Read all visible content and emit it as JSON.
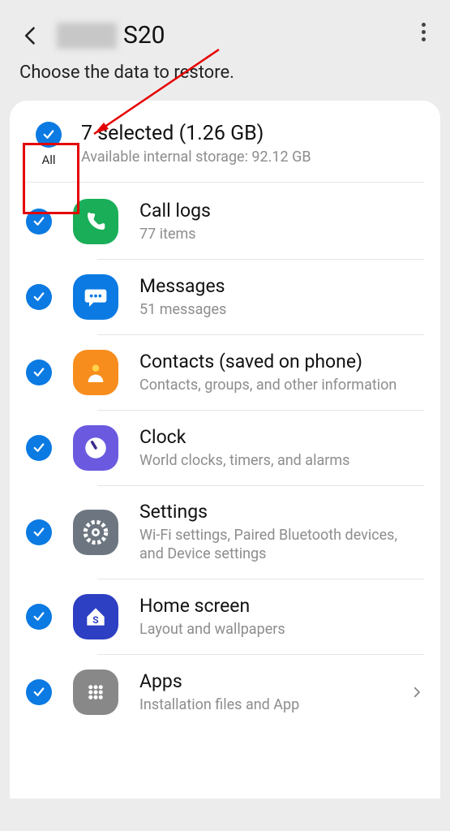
{
  "header": {
    "title": "S20"
  },
  "subtitle": "Choose the data to restore.",
  "all": {
    "label": "All"
  },
  "summary": {
    "selected": "7 selected (1.26 GB)",
    "storage": "Available internal storage: 92.12 GB"
  },
  "items": [
    {
      "title": "Call logs",
      "sub": "77 items"
    },
    {
      "title": "Messages",
      "sub": "51 messages"
    },
    {
      "title": "Contacts (saved on phone)",
      "sub": "Contacts, groups, and other information"
    },
    {
      "title": "Clock",
      "sub": "World clocks, timers, and alarms"
    },
    {
      "title": "Settings",
      "sub": "Wi-Fi settings, Paired Bluetooth devices, and Device settings"
    },
    {
      "title": "Home screen",
      "sub": "Layout and wallpapers"
    },
    {
      "title": "Apps",
      "sub": "Installation files and App"
    }
  ]
}
